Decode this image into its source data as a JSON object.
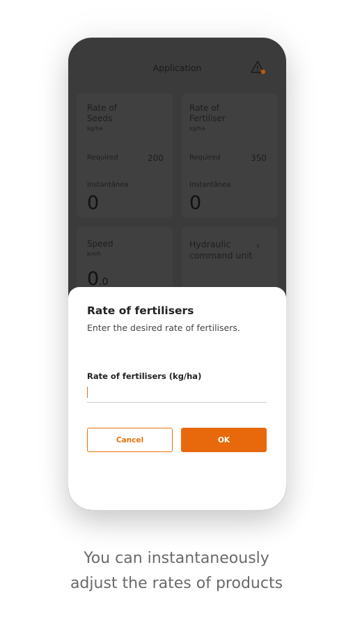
{
  "app": {
    "title": "Application",
    "warning_icon": "warning-triangle-icon",
    "warning_dot_color": "#e8710a"
  },
  "cards": {
    "seeds": {
      "title": "Rate of\nSeeds",
      "unit": "kg/ha",
      "required_label": "Required",
      "required_value": "200",
      "instant_label": "Instantânea",
      "instant_value": "0"
    },
    "fertiliser": {
      "title": "Rate of\nFertiliser",
      "unit": "kg/ha",
      "required_label": "Required",
      "required_value": "350",
      "instant_label": "Instantânea",
      "instant_value": "0"
    },
    "speed": {
      "title": "Speed",
      "unit": "km/h",
      "value_int": "0",
      "value_dec": ".0"
    },
    "hydraulic": {
      "title": "Hydraulic\ncommand unit",
      "chevron": "›"
    }
  },
  "dialog": {
    "title": "Rate of fertilisers",
    "subtitle": "Enter the desired rate of fertilisers.",
    "field_label": "Rate of fertilisers (kg/ha)",
    "field_value": "",
    "cancel_label": "Cancel",
    "ok_label": "OK"
  },
  "colors": {
    "accent": "#e8710a",
    "overlay": "#3b3b3b"
  },
  "caption": {
    "line1": "You can instantaneously",
    "line2": "adjust the rates of products"
  }
}
